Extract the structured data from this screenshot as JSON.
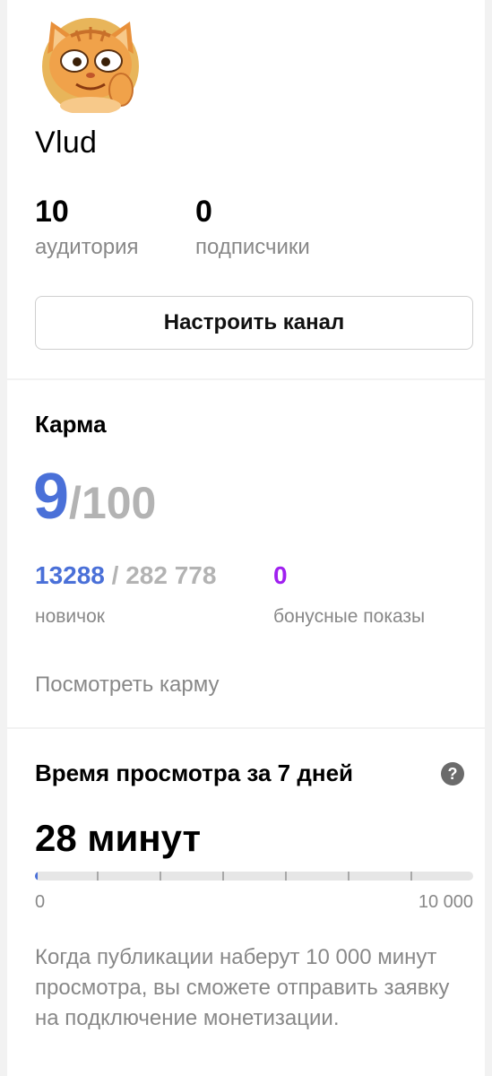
{
  "profile": {
    "avatar_icon": "cat-avatar-icon",
    "name": "Vlud",
    "audience": {
      "value": "10",
      "label": "аудитория"
    },
    "subscribers": {
      "value": "0",
      "label": "подписчики"
    },
    "setup_button_label": "Настроить канал"
  },
  "karma": {
    "title": "Карма",
    "score": "9",
    "score_max": "/100",
    "progress_value": "13288",
    "progress_total": " / 282 778",
    "level": "новичок",
    "bonus_value": "0",
    "bonus_label": "бонусные показы",
    "link_label": "Посмотреть карму"
  },
  "watch_time": {
    "title": "Время просмотра за 7 дней",
    "help_icon": "help-icon",
    "help_glyph": "?",
    "value": "28 минут",
    "progress": 0.0028,
    "scale_min": "0",
    "scale_max": "10 000",
    "description": "Когда публикации наберут 10 000 минут просмотра, вы сможете отправить заявку на подключение монетизации."
  },
  "colors": {
    "accent": "#4a70d8",
    "bonus": "#a020f0",
    "muted": "#888888",
    "background": "#f2f2f2"
  }
}
